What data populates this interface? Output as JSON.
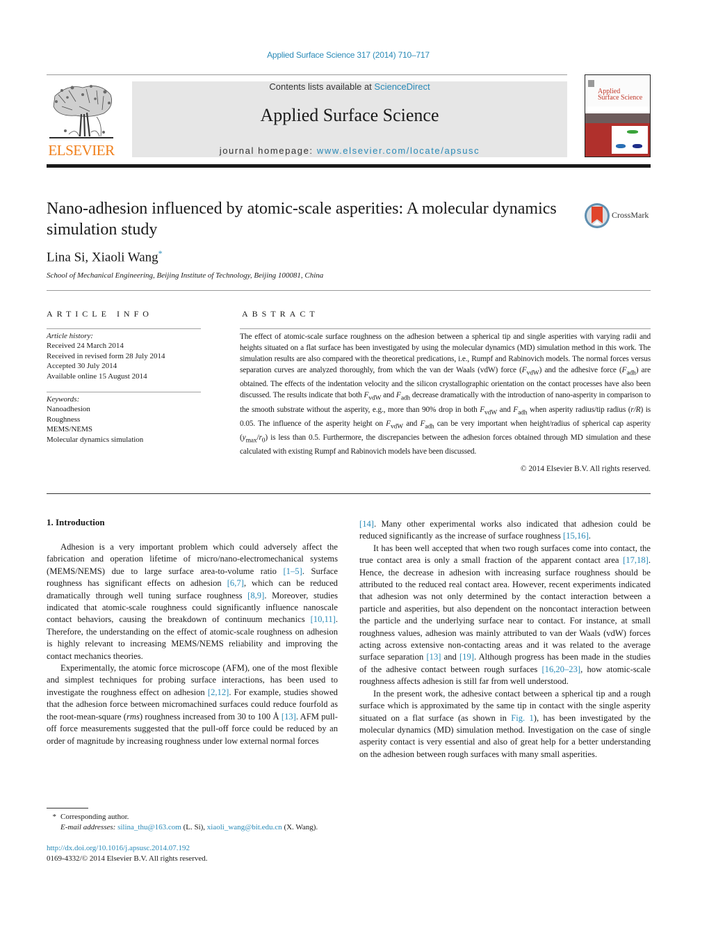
{
  "header": {
    "citation": "Applied Surface Science 317 (2014) 710–717",
    "contents_prefix": "Contents lists available at ",
    "contents_link": "ScienceDirect",
    "journal_title": "Applied Surface Science",
    "homepage_prefix": "journal homepage: ",
    "homepage_link": "www.elsevier.com/locate/apsusc",
    "publisher_logo_text": "ELSEVIER",
    "cover_title_line1": "Applied",
    "cover_title_line2": "Surface Science",
    "logo_color": "#f07f1a",
    "link_color": "#2a8ab7"
  },
  "article": {
    "title": "Nano-adhesion influenced by atomic-scale asperities: A molecular dynamics simulation study",
    "crossmark_label": "CrossMark",
    "authors": "Lina Si, Xiaoli Wang",
    "author_marker": "*",
    "affiliation": "School of Mechanical Engineering, Beijing Institute of Technology, Beijing 100081, China"
  },
  "article_info": {
    "heading": "ARTICLE INFO",
    "history_label": "Article history:",
    "history": [
      "Received 24 March 2014",
      "Received in revised form 28 July 2014",
      "Accepted 30 July 2014",
      "Available online 15 August 2014"
    ],
    "keywords_label": "Keywords:",
    "keywords": [
      "Nanoadhesion",
      "Roughness",
      "MEMS/NEMS",
      "Molecular dynamics simulation"
    ]
  },
  "abstract": {
    "heading": "ABSTRACT",
    "s1": "The effect of atomic-scale surface roughness on the adhesion between a spherical tip and single asperities with varying radii and heights situated on a flat surface has been investigated by using the molecular dynamics (MD) simulation method in this work. The simulation results are also compared with the theoretical predications, i.e., Rumpf and Rabinovich models. The normal forces versus separation curves are analyzed thoroughly, from which the van der Waals (vdW) force (",
    "s2": ") and the adhesive force (",
    "s3": ") are obtained. The effects of the indentation velocity and the silicon crystallographic orientation on the contact processes have also been discussed. The results indicate that both ",
    "s4": " and ",
    "s5": " decrease dramatically with the introduction of nano-asperity in comparison to the smooth substrate without the asperity, e.g., more than 90% drop in both ",
    "s6": " and ",
    "s7": " when asperity radius/tip radius (",
    "s8": ") is 0.05. The influence of the asperity height on ",
    "s9": " and ",
    "s10": " can be very important when height/radius of spherical cap asperity (",
    "s11": ") is less than 0.5. Furthermore, the discrepancies between the adhesion forces obtained through MD simulation and these calculated with existing Rumpf and Rabinovich models have been discussed.",
    "F": "F",
    "vdw": "vdW",
    "adh": "adh",
    "rR": "r/R",
    "y": "y",
    "max": "max",
    "r0_r": "r",
    "r0_sub": "0",
    "slash": "/",
    "copyright": "© 2014 Elsevier B.V. All rights reserved."
  },
  "body": {
    "section_heading": "1.  Introduction",
    "p1_a": "Adhesion is a very important problem which could adversely affect the fabrication and operation lifetime of micro/nano-electromechanical systems (MEMS/NEMS) due to large surface area-to-volume ratio ",
    "p1_r1": "[1–5]",
    "p1_b": ". Surface roughness has significant effects on adhesion ",
    "p1_r2": "[6,7]",
    "p1_c": ", which can be reduced dramatically through well tuning surface roughness ",
    "p1_r3": "[8,9]",
    "p1_d": ". Moreover, studies indicated that atomic-scale roughness could significantly influence nanoscale contact behaviors, causing the breakdown of continuum mechanics ",
    "p1_r4": "[10,11]",
    "p1_e": ". Therefore, the understanding on the effect of atomic-scale roughness on adhesion is highly relevant to increasing MEMS/NEMS reliability and improving the contact mechanics theories.",
    "p2_a": "Experimentally, the atomic force microscope (AFM), one of the most flexible and simplest techniques for probing surface interactions, has been used to investigate the roughness effect on adhesion ",
    "p2_r1": "[2,12]",
    "p2_b": ". For example, studies showed that the adhesion force between micromachined surfaces could reduce fourfold as the root-mean-square (",
    "p2_rms": "rms",
    "p2_c": ") roughness increased from 30 to 100 Å ",
    "p2_r2": "[13]",
    "p2_d": ". AFM pull-off force measurements suggested that the pull-off force could be reduced by an order of magnitude by increasing roughness under low external normal forces ",
    "p2_r3": "[14]",
    "p2_e": ". Many other experimental works also indicated that adhesion could be reduced significantly as the increase of surface roughness ",
    "p2_r4": "[15,16]",
    "p2_f": ".",
    "p3_a": "It has been well accepted that when two rough surfaces come into contact, the true contact area is only a small fraction of the apparent contact area ",
    "p3_r1": "[17,18]",
    "p3_b": ". Hence, the decrease in adhesion with increasing surface roughness should be attributed to the reduced real contact area. However, recent experiments indicated that adhesion was not only determined by the contact interaction between a particle and asperities, but also dependent on the noncontact interaction between the particle and the underlying surface near to contact. For instance, at small roughness values, adhesion was mainly attributed to van der Waals (vdW) forces acting across extensive non-contacting areas and it was related to the average surface separation ",
    "p3_r2": "[13]",
    "p3_c": " and ",
    "p3_r3": "[19]",
    "p3_d": ". Although progress has been made in the studies of the adhesive contact between rough surfaces ",
    "p3_r4": "[16,20–23]",
    "p3_e": ", how atomic-scale roughness affects adhesion is still far from well understood.",
    "p4_a": "In the present work, the adhesive contact between a spherical tip and a rough surface which is approximated by the same tip in contact with the single asperity situated on a flat surface (as shown in ",
    "p4_r1": "Fig. 1",
    "p4_b": "), has been investigated by the molecular dynamics (MD) simulation method. Investigation on the case of single asperity contact is very essential and also of great help for a better understanding on the adhesion between rough surfaces with many small asperities."
  },
  "footnotes": {
    "star": "*",
    "corresponding": "Corresponding author.",
    "email_label": "E-mail addresses:",
    "email1": "silina_thu@163.com",
    "email1_owner": " (L. Si), ",
    "email2": "xiaoli_wang@bit.edu.cn",
    "email2_owner": " (X. Wang).",
    "doi": "http://dx.doi.org/10.1016/j.apsusc.2014.07.192",
    "issn": "0169-4332/© 2014 Elsevier B.V. All rights reserved."
  }
}
